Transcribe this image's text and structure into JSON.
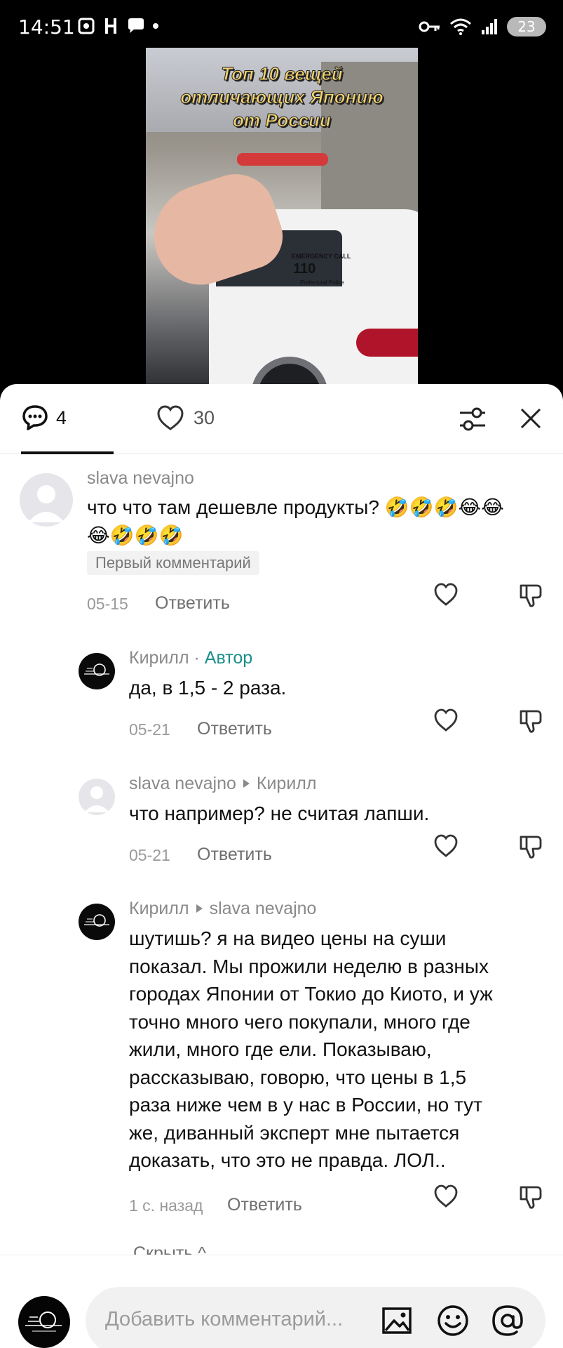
{
  "status_bar": {
    "time": "14:51",
    "battery": "23",
    "left_icons": [
      "screen-record-icon",
      "app-h-icon",
      "chat-bubble-icon",
      "dot-icon"
    ],
    "right_icons": [
      "key-icon",
      "wifi-icon",
      "signal-icon",
      "battery-icon"
    ]
  },
  "video": {
    "overlay_title_lines": [
      "Топ 10 вещей",
      "отличающих Японию",
      "от России"
    ],
    "car_text_lines": [
      "EMERGENCY CALL",
      "110",
      "Prefectural Police"
    ]
  },
  "tabs": {
    "comments_count": "4",
    "likes_count": "30"
  },
  "comments": [
    {
      "author": "slava nevajno",
      "text_line1": "что что там дешевле продукты? 🤣🤣🤣😂😂",
      "text_line2": "😂🤣🤣🤣",
      "badge": "Первый комментарий",
      "date": "05-15",
      "reply_label": "Ответить"
    },
    {
      "author": "Кирилл",
      "author_separator": " · ",
      "author_tag": "Автор",
      "text": "да, в 1,5 - 2 раза.",
      "date": "05-21",
      "reply_label": "Ответить"
    },
    {
      "author": "slava nevajno",
      "reply_to": "Кирилл",
      "text": "что например? не считая лапши.",
      "date": "05-21",
      "reply_label": "Ответить"
    },
    {
      "author": "Кирилл",
      "reply_to": "slava nevajno",
      "text_lines": [
        "шутишь? я на видео цены на суши",
        "показал. Мы прожили неделю в разных",
        "городах Японии от Токио до Киото, и уж",
        "точно много чего покупали, много где",
        "жили, много где ели. Показываю,",
        "рассказываю, говорю, что цены в 1,5",
        "раза ниже чем в у нас в России, но тут",
        "же, диванный эксперт мне пытается",
        "доказать, что это не правда. ЛОЛ.."
      ],
      "date": "1 с. назад",
      "reply_label": "Ответить"
    }
  ],
  "hide_label": "Скрыть ^",
  "composer": {
    "placeholder": "Добавить комментарий..."
  },
  "colors": {
    "author_tag": "#1a8f8a",
    "muted_text": "#8a8a8a",
    "panel_bg": "#ffffff"
  }
}
